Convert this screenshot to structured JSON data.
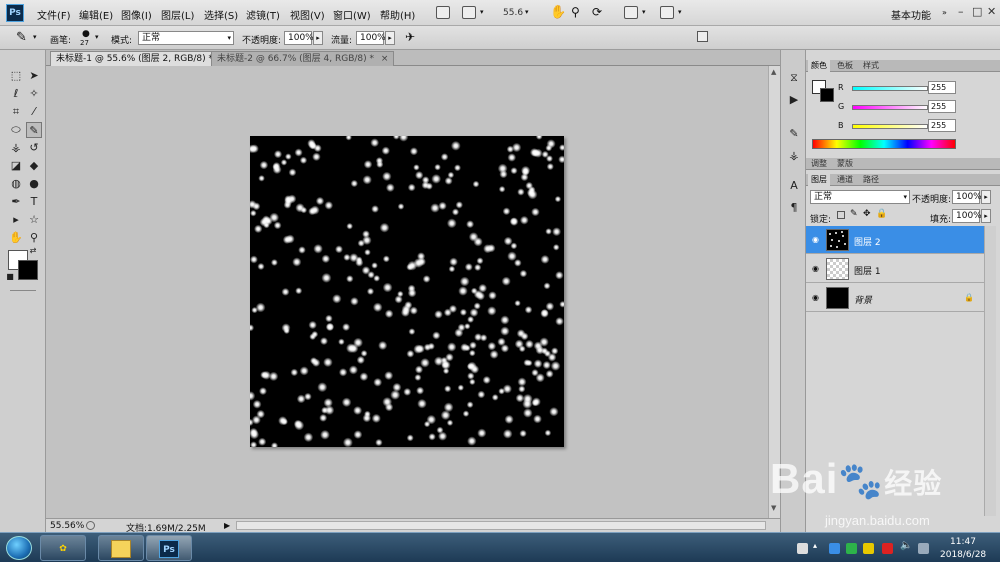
{
  "menubar": {
    "logo": "Ps",
    "items": [
      "文件(F)",
      "编辑(E)",
      "图像(I)",
      "图层(L)",
      "选择(S)",
      "滤镜(T)",
      "视图(V)",
      "窗口(W)",
      "帮助(H)"
    ],
    "zoom": "55.6",
    "workspace": "基本功能",
    "win_controls": [
      "–",
      "□",
      "✕"
    ]
  },
  "options": {
    "brush_label": "画笔:",
    "brush_size": "27",
    "mode_label": "模式:",
    "mode_value": "正常",
    "opacity_label": "不透明度:",
    "opacity_value": "100%",
    "flow_label": "流量:",
    "flow_value": "100%"
  },
  "tabs": [
    {
      "label": "未标题-1 @ 55.6% (图层 2, RGB/8) *",
      "close": "×"
    },
    {
      "label": "未标题-2 @ 66.7% (图层 4, RGB/8) *",
      "close": "×"
    }
  ],
  "status": {
    "zoom": "55.56%",
    "doc": "文档:1.69M/2.25M"
  },
  "color_panel": {
    "tabs": [
      "颜色",
      "色板",
      "样式"
    ],
    "channels": [
      {
        "label": "R",
        "value": "255",
        "color": "#00e5e5"
      },
      {
        "label": "G",
        "value": "255",
        "color": "#e500e5"
      },
      {
        "label": "B",
        "value": "255",
        "color": "#e5e500"
      }
    ]
  },
  "adjust_tabs": [
    "调整",
    "蒙版"
  ],
  "layers_panel": {
    "tabs": [
      "图层",
      "通道",
      "路径"
    ],
    "blend_mode": "正常",
    "opacity_label": "不透明度:",
    "opacity_value": "100%",
    "lock_label": "锁定:",
    "fill_label": "填充:",
    "fill_value": "100%",
    "layers": [
      {
        "name": "图层 2",
        "selected": true
      },
      {
        "name": "图层 1",
        "selected": false
      },
      {
        "name": "背景",
        "selected": false
      }
    ]
  },
  "watermark": {
    "logo": "Bai",
    "logo_tail": "经验",
    "url": "jingyan.baidu.com"
  },
  "taskbar": {
    "time": "11:47",
    "date": "2018/6/28",
    "ps_label": "Ps"
  },
  "accent": "#3a8ee6"
}
